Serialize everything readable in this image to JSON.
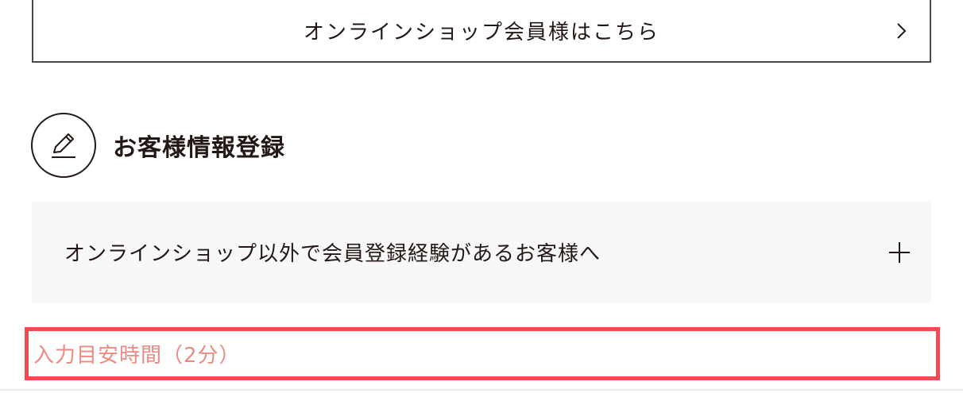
{
  "member_link": {
    "label": "オンラインショップ会員様はこちら",
    "icon": "chevron-right-icon"
  },
  "section": {
    "title": "お客様情報登録",
    "icon": "pen-icon"
  },
  "accordion": {
    "label": "オンラインショップ以外で会員登録経験があるお客様へ",
    "icon": "plus-icon",
    "expanded": false
  },
  "time_estimate": {
    "label": "入力目安時間（2分）"
  },
  "colors": {
    "text": "#231815",
    "border": "#4a4a4a",
    "accordion_bg": "#f8f8f8",
    "highlight_border": "#ee4b52",
    "time_text": "#ec8a82"
  }
}
